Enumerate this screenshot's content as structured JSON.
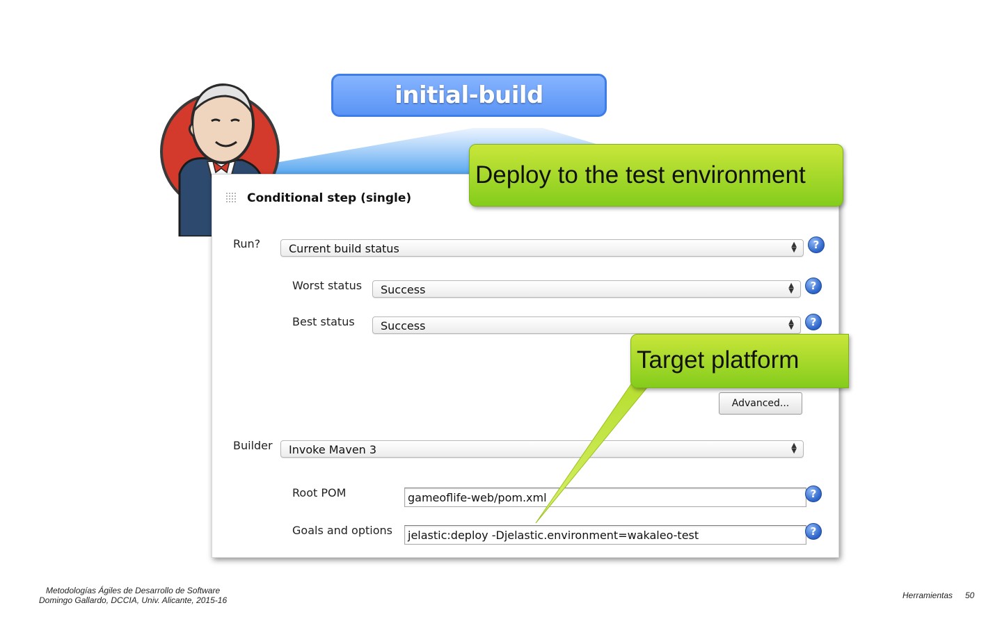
{
  "header": {
    "job_title": "initial-build"
  },
  "callouts": {
    "deploy": "Deploy to the test environment",
    "target": "Target platform"
  },
  "panel": {
    "title": "Conditional step (single)",
    "run": {
      "label": "Run?",
      "value": "Current build status"
    },
    "worst": {
      "label": "Worst status",
      "value": "Success"
    },
    "best": {
      "label": "Best status",
      "value": "Success"
    },
    "advanced_label": "Advanced...",
    "builder": {
      "label": "Builder",
      "value": "Invoke Maven 3"
    },
    "root_pom": {
      "label": "Root POM",
      "value": "gameoflife-web/pom.xml"
    },
    "goals": {
      "label": "Goals and options",
      "value": "jelastic:deploy -Djelastic.environment=wakaleo-test"
    },
    "help_glyph": "?"
  },
  "footer": {
    "line1": "Metodologías Ágiles de Desarrollo de Software",
    "line2": "Domingo Gallardo, DCCIA, Univ. Alicante, 2015-16",
    "section": "Herramientas",
    "page": "50"
  },
  "colors": {
    "job_bubble": "#5a94f5",
    "callout_green": "#a4d82a",
    "help_blue": "#2b63c9",
    "mascot_red": "#d33a2c"
  },
  "icons": [
    "jenkins-mascot-icon",
    "grip-icon",
    "help-icon",
    "select-arrows-icon"
  ]
}
